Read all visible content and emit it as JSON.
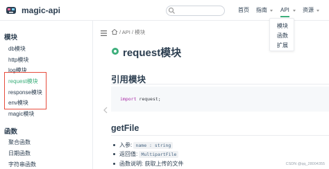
{
  "navbar": {
    "site_title": "magic-api",
    "links": [
      {
        "label": "首页"
      },
      {
        "label": "指南"
      },
      {
        "label": "API"
      },
      {
        "label": "资源"
      }
    ]
  },
  "dropdown": {
    "items": [
      "模块",
      "函数",
      "扩展"
    ]
  },
  "sidebar": {
    "sections": [
      {
        "title": "模块",
        "items": [
          "db模块",
          "http模块",
          "log模块",
          "request模块",
          "response模块",
          "env模块",
          "magic模块"
        ]
      },
      {
        "title": "函数",
        "items": [
          "聚合函数",
          "日期函数",
          "字符串函数"
        ]
      }
    ],
    "active_item": "request模块"
  },
  "main": {
    "breadcrumb": "/ API / 模块",
    "title": "request模块",
    "sections": [
      {
        "heading": "引用模块",
        "code": {
          "keyword": "import",
          "rest": "request;"
        }
      },
      {
        "heading": "getFile",
        "bullets": [
          {
            "label": "入参:",
            "code": "name : string"
          },
          {
            "label": "返回值:",
            "code": "MultipartFile"
          },
          {
            "label": "函数说明:",
            "text": "获取上传的文件"
          }
        ]
      }
    ]
  },
  "watermark": "CSDN @qq_28004355",
  "colors": {
    "accent": "#3eaf7c",
    "highlight_box": "#e74c3c",
    "code_bg": "#f6f8fa"
  },
  "icons": [
    "logo-icon",
    "search-icon",
    "menu-icon",
    "home-icon",
    "module-icon",
    "chevron-left-icon"
  ]
}
